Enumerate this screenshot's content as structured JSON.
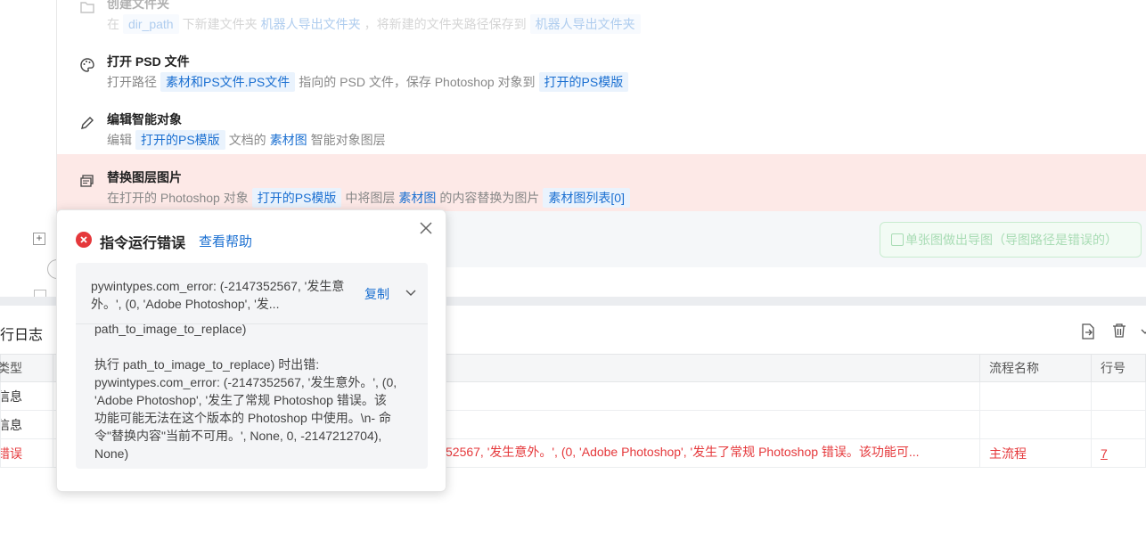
{
  "workflow": {
    "steps": [
      {
        "title": "创建文件夹",
        "desc": [
          {
            "t": "text",
            "v": "在"
          },
          {
            "t": "tag",
            "v": "dir_path"
          },
          {
            "t": "text",
            "v": "下新建文件夹"
          },
          {
            "t": "plain_tag",
            "v": "机器人导出文件夹"
          },
          {
            "t": "text",
            "v": "，将新建的文件夹路径保存到"
          },
          {
            "t": "tag",
            "v": "机器人导出文件夹"
          }
        ],
        "icon": "folder-add-icon"
      },
      {
        "title": "打开 PSD 文件",
        "desc": [
          {
            "t": "text",
            "v": "打开路径"
          },
          {
            "t": "tag",
            "v": "素材和PS文件.PS文件"
          },
          {
            "t": "text",
            "v": "指向的 PSD 文件，保存 Photoshop 对象到"
          },
          {
            "t": "tag",
            "v": "打开的PS模版"
          }
        ],
        "icon": "palette-icon"
      },
      {
        "title": "编辑智能对象",
        "desc": [
          {
            "t": "text",
            "v": "编辑"
          },
          {
            "t": "tag",
            "v": "打开的PS模版"
          },
          {
            "t": "text",
            "v": "文档的"
          },
          {
            "t": "plain_tag",
            "v": "素材图"
          },
          {
            "t": "text",
            "v": "智能对象图层"
          }
        ],
        "icon": "pencil-icon"
      },
      {
        "title": "替换图层图片",
        "desc": [
          {
            "t": "text",
            "v": "在打开的 Photoshop 对象"
          },
          {
            "t": "tag",
            "v": "打开的PS模版"
          },
          {
            "t": "text",
            "v": "中将图层"
          },
          {
            "t": "plain_tag",
            "v": "素材图"
          },
          {
            "t": "text",
            "v": "的内容替换为图片"
          },
          {
            "t": "tag",
            "v": "素材图列表[0]"
          }
        ],
        "icon": "image-replace-icon"
      }
    ],
    "export_button": "单张图做出导图（导图路径是错误的）",
    "expand_symbol": "+"
  },
  "log": {
    "title": "运行日志",
    "columns": [
      "类型",
      "",
      "流程名称",
      "行号"
    ],
    "rows": [
      {
        "type": "信息",
        "message": "",
        "flow": "",
        "line": ""
      },
      {
        "type": "信息",
        "message": "",
        "flow": "",
        "line": ""
      },
      {
        "type": "错误",
        "message": "52567, '发生意外。', (0, 'Adobe Photoshop', '发生了常规 Photoshop 错误。该功能可...",
        "flow": "主流程",
        "line": "7"
      }
    ]
  },
  "popup": {
    "title": "指令运行错误",
    "help": "查看帮助",
    "summary": "pywintypes.com_error: (-2147352567, '发生意外。', (0, 'Adobe Photoshop', '发...",
    "copy": "复制",
    "body": "path_to_image_to_replace)\n\n执行 path_to_image_to_replace) 时出错: pywintypes.com_error: (-2147352567, '发生意外。', (0, 'Adobe Photoshop', '发生了常规 Photoshop 错误。该功能可能无法在这个版本的 Photoshop 中使用。\\n- 命令\"替换内容\"当前不可用。', None, 0, -2147212704), None)"
  },
  "colors": {
    "accent": "#1a6fd1",
    "error": "#e5383b",
    "error_row_bg": "#fde9e7"
  }
}
